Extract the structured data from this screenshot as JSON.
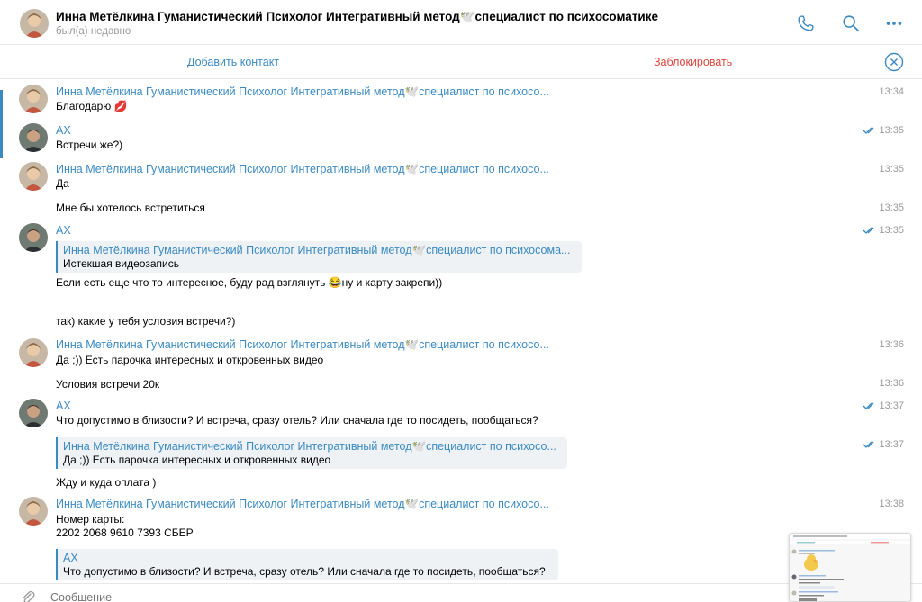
{
  "header": {
    "title": "Инна Метёлкина Гуманистический Психолог Интегративный метод🕊️специалист по психосоматике",
    "status": "был(а) недавно",
    "icons": [
      "phone-icon",
      "search-icon",
      "more-icon"
    ]
  },
  "actions": {
    "add_contact": "Добавить контакт",
    "block": "Заблокировать",
    "close_icon": "close-icon"
  },
  "colors": {
    "accent": "#3a8ac1",
    "danger": "#e0463d",
    "muted": "#999999"
  },
  "messages": [
    {
      "sender": "Инна Метёлкина Гуманистический Психолог Интегративный метод🕊️специалист по психосо...",
      "text": "Благодарю 💋",
      "time": "13:34"
    },
    {
      "sender": "AX",
      "text": "Встречи же?)",
      "time": "13:35",
      "read": true
    },
    {
      "sender": "Инна Метёлкина Гуманистический Психолог Интегративный метод🕊️специалист по психосо...",
      "text": "Да",
      "time": "13:35"
    },
    {
      "text": "Мне бы хотелось встретиться",
      "time": "13:35"
    },
    {
      "sender": "AX",
      "time": "13:35",
      "read": true,
      "quote": {
        "name": "Инна Метёлкина Гуманистический Психолог Интегративный метод🕊️специалист по психосома...",
        "text": "Истекшая видеозапись"
      },
      "text": "Если есть еще что то интересное, буду рад взглянуть 😂ну и карту закрепи))",
      "text2": "так) какие у тебя условия встречи?)"
    },
    {
      "sender": "Инна Метёлкина Гуманистический Психолог Интегративный метод🕊️специалист по психосо...",
      "text": "Да ;)) Есть парочка интересных и откровенных видео",
      "time": "13:36"
    },
    {
      "text": "Условия встречи 20к",
      "time": "13:36"
    },
    {
      "sender": "AX",
      "text": "Что допустимо в близости? И встреча, сразу отель? Или сначала где то посидеть, пообщаться?",
      "time": "13:37",
      "read": true
    },
    {
      "time": "13:37",
      "read": true,
      "quote": {
        "name": "Инна Метёлкина Гуманистический Психолог Интегративный метод🕊️специалист по психосо...",
        "text": "Да ;)) Есть парочка интересных и откровенных видео"
      },
      "text": "Жду и куда оплата )"
    },
    {
      "sender": "Инна Метёлкина Гуманистический Психолог Интегративный метод🕊️специалист по психосо...",
      "time": "13:38",
      "text": "Номер карты:",
      "text2": "2202 2068 9610 7393   СБЕР",
      "quote": {
        "name": "AX",
        "text": "Что допустимо в близости? И встреча, сразу отель? Или сначала где то посидеть, пообщаться?"
      }
    }
  ],
  "composer": {
    "placeholder": "Сообщение",
    "attach_icon": "paperclip-icon"
  }
}
